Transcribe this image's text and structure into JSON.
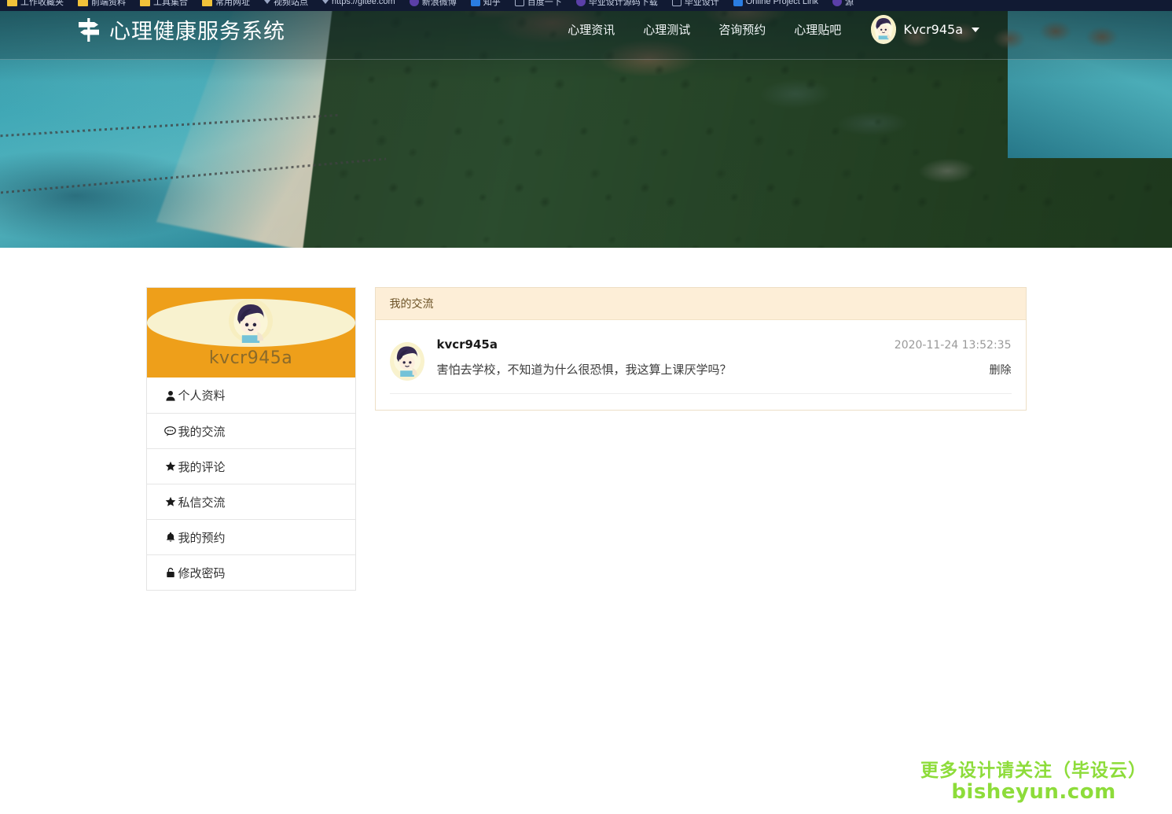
{
  "browser": {
    "bookmarks": [
      {
        "icon": "folder-icon",
        "label": "工作收藏夹"
      },
      {
        "icon": "folder-icon",
        "label": "前端资料"
      },
      {
        "icon": "folder-icon",
        "label": "工具集合"
      },
      {
        "icon": "folder-icon",
        "label": "常用网址"
      },
      {
        "icon": "chevron-down-icon",
        "label": "视频站点"
      },
      {
        "icon": "chevron-down-icon",
        "label": "https://gitee.com"
      },
      {
        "icon": "bookmark-icon",
        "label": "新浪微博"
      },
      {
        "icon": "bookmark-icon",
        "label": "知乎"
      },
      {
        "icon": "square-icon",
        "label": "百度一下"
      },
      {
        "icon": "bookmark-icon",
        "label": "毕业设计源码下载"
      },
      {
        "icon": "square-icon",
        "label": "毕业设计"
      },
      {
        "icon": "bookmark-icon",
        "label": "Online Project Link"
      },
      {
        "icon": "bookmark-icon",
        "label": "源"
      }
    ]
  },
  "navbar": {
    "logo_icon": "signpost-icon",
    "brand": "心理健康服务系统",
    "links": [
      {
        "label": "心理资讯"
      },
      {
        "label": "心理测试"
      },
      {
        "label": "咨询预约"
      },
      {
        "label": "心理贴吧"
      }
    ],
    "user": {
      "avatar_icon": "user-avatar",
      "name": "Kvcr945a",
      "caret_icon": "caret-down-icon"
    }
  },
  "sidebar": {
    "avatar_icon": "user-avatar",
    "username": "kvcr945a",
    "accent_color": "#EE9F1A",
    "items": [
      {
        "icon": "user-icon",
        "label": "个人资料"
      },
      {
        "icon": "comment-icon",
        "label": "我的交流"
      },
      {
        "icon": "star-icon",
        "label": "我的评论"
      },
      {
        "icon": "star-icon",
        "label": "私信交流"
      },
      {
        "icon": "bell-icon",
        "label": "我的预约"
      },
      {
        "icon": "lock-icon",
        "label": "修改密码"
      }
    ]
  },
  "panel": {
    "title": "我的交流",
    "header_bg": "#FDEED7",
    "comments": [
      {
        "avatar_icon": "user-avatar",
        "author": "kvcr945a",
        "time": "2020-11-24 13:52:35",
        "text": "害怕去学校，不知道为什么很恐惧，我这算上课厌学吗？",
        "delete_label": "删除"
      }
    ]
  },
  "watermark": {
    "line1": "更多设计请关注（毕设云）",
    "line2": "bisheyun.com",
    "color": "#8DDC3A"
  }
}
